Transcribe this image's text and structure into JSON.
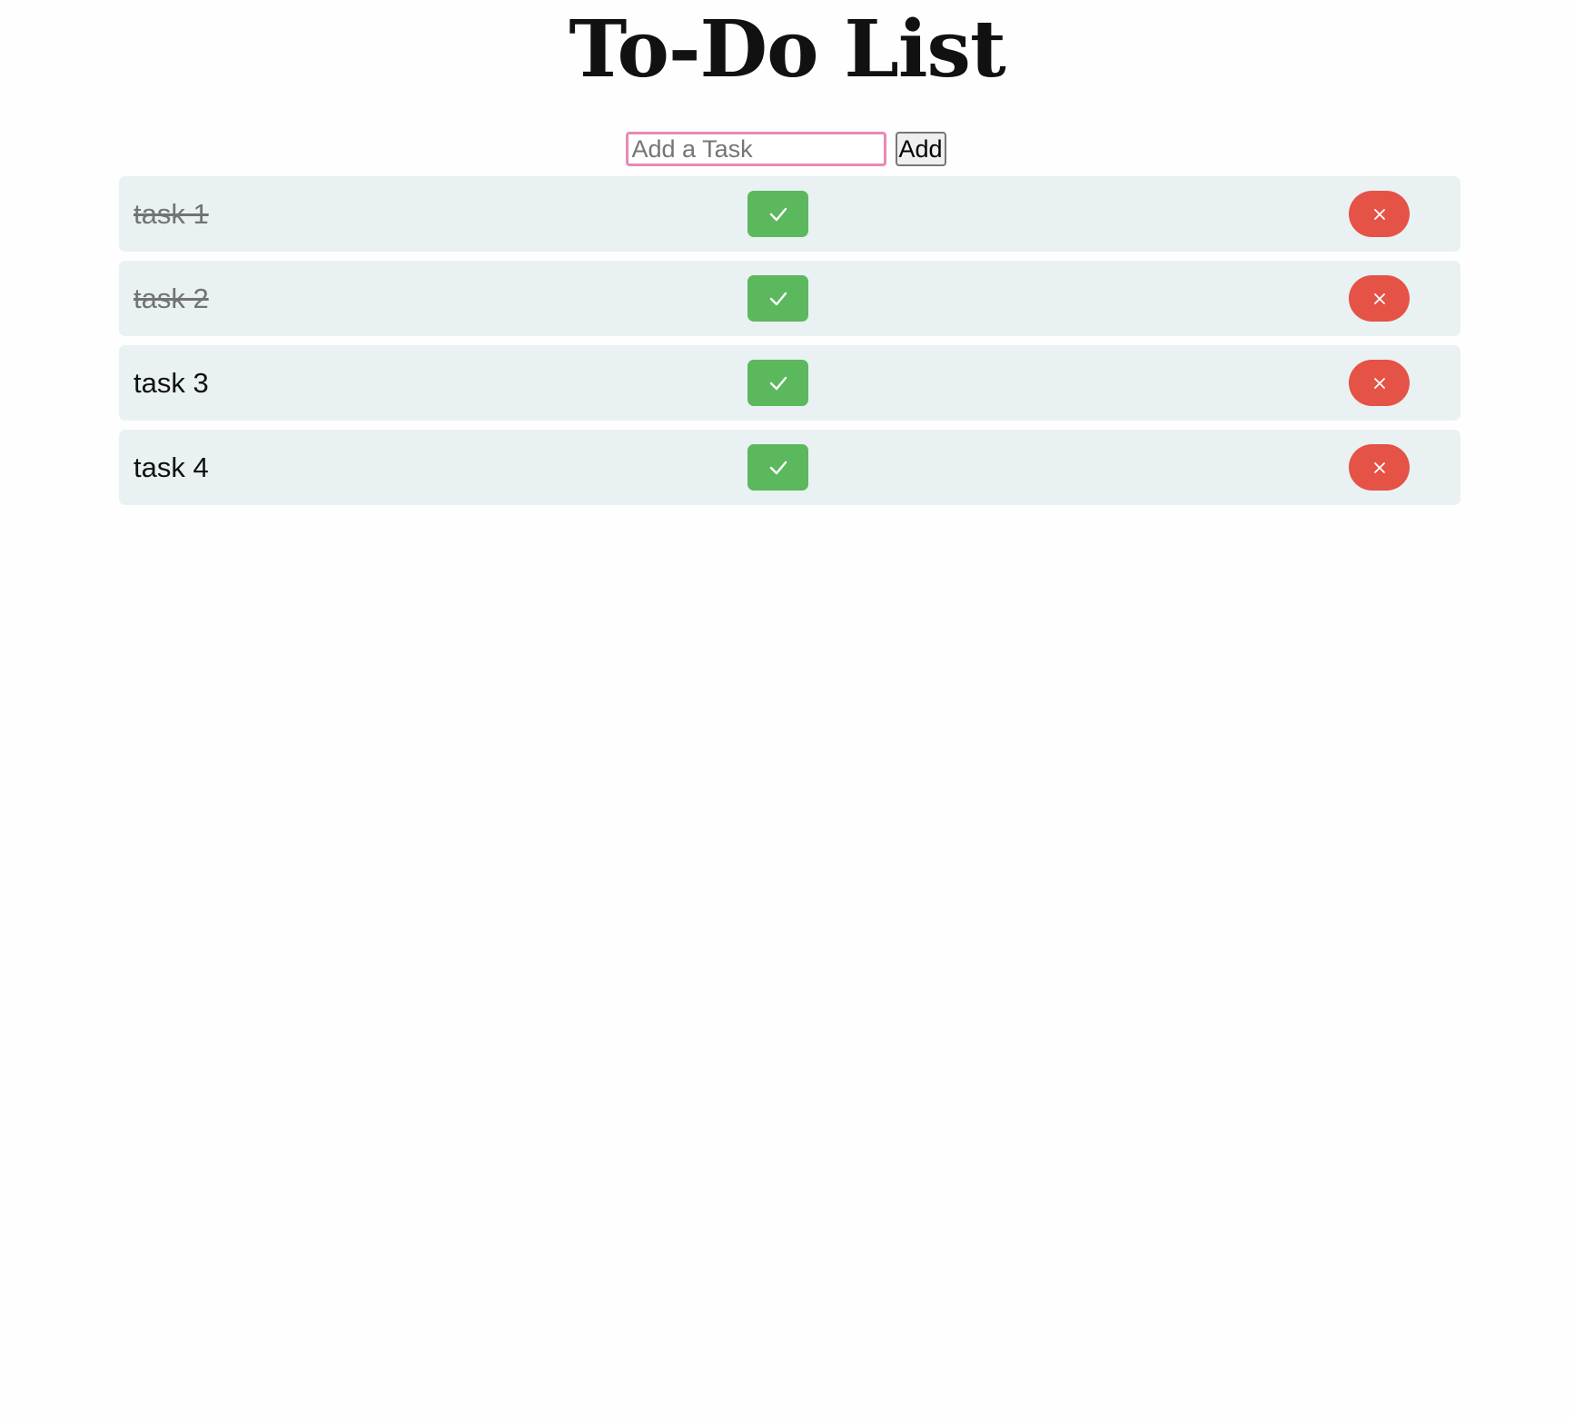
{
  "app": {
    "title": "To-Do List"
  },
  "add_form": {
    "input_placeholder": "Add a Task",
    "input_value": "",
    "add_label": "Add"
  },
  "tasks": [
    {
      "label": "task 1",
      "completed": true
    },
    {
      "label": "task 2",
      "completed": true
    },
    {
      "label": "task 3",
      "completed": false
    },
    {
      "label": "task 4",
      "completed": false
    }
  ],
  "icons": {
    "complete": "check-icon",
    "delete": "close-icon"
  },
  "colors": {
    "input_focus_border": "#e88ab4",
    "row_background": "#e9f1f3",
    "complete_button": "#5cb85c",
    "delete_button": "#e55246",
    "done_text": "#737373"
  }
}
